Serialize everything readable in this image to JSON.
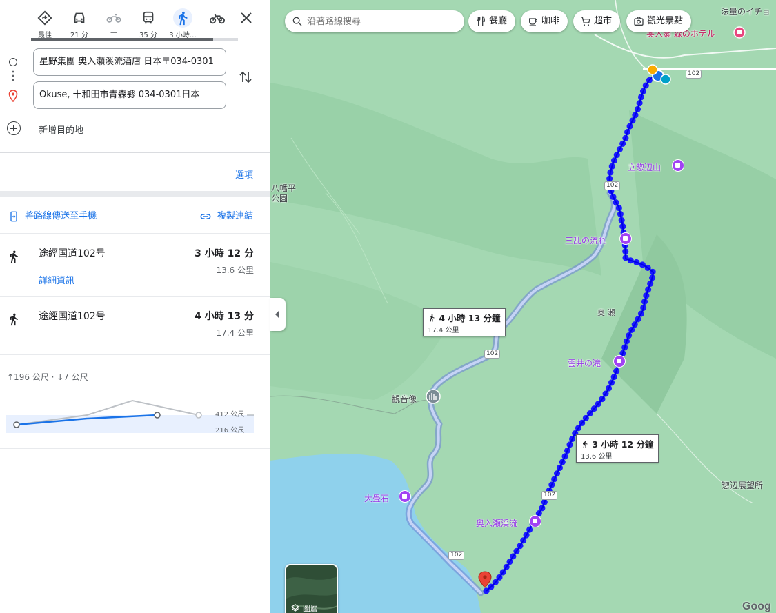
{
  "travel_modes": [
    {
      "name": "best",
      "label": "最佳",
      "icon": "directions-diamond-icon"
    },
    {
      "name": "driving",
      "label": "21 分",
      "icon": "car-icon"
    },
    {
      "name": "motorcycle",
      "label": "—",
      "icon": "motorcycle-icon"
    },
    {
      "name": "transit",
      "label": "35 分",
      "icon": "bus-icon"
    },
    {
      "name": "walking",
      "label": "3 小時…",
      "icon": "walk-icon",
      "selected": true
    },
    {
      "name": "cycling",
      "label": "",
      "icon": "bicycle-icon"
    }
  ],
  "waypoints": {
    "origin": "星野集團 奥入瀬溪流酒店 日本〒034-0301",
    "destination": "Okuse, 十和田市青森縣 034-0301日本",
    "add_destination": "新增目的地"
  },
  "options_label": "選項",
  "actions": {
    "send_to_phone": "將路線傳送至手機",
    "copy_link": "複製連結"
  },
  "routes": [
    {
      "via": "途經国道102号",
      "duration": "3 小時 12 分",
      "distance": "13.6 公里",
      "details": "詳細資訊"
    },
    {
      "via": "途經国道102号",
      "duration": "4 小時 13 分",
      "distance": "17.4 公里"
    }
  ],
  "elevation": {
    "summary": "↑196 公尺 · ↓7 公尺",
    "max_label": "412 公尺",
    "min_label": "216 公尺"
  },
  "map": {
    "search_placeholder": "沿著路線搜尋",
    "chips": [
      "餐廳",
      "咖啡",
      "超市",
      "觀光景點"
    ],
    "pois": {
      "hotel_top": "法量のイチョ",
      "hotel_mori": "奥入瀬 森のホテル",
      "tatsu": "立惣辺山",
      "sanran": "三乱の流れ",
      "oirase_area": "奥 瀬",
      "kumoi": "雲井の滝",
      "kannon": "観音像",
      "odatami": "大畳石",
      "oirase_keiryu": "奥入瀬渓流",
      "hachimantai": "八幡平",
      "park": "公園",
      "soheki": "惣辺展望所"
    },
    "route_label": "102",
    "callout_main": {
      "time": "3 小時 12 分鐘",
      "dist": "13.6 公里"
    },
    "callout_alt": {
      "time": "4 小時 13 分鐘",
      "dist": "17.4 公里"
    },
    "layers_label": "圖層",
    "brand": "Goog"
  },
  "colors": {
    "route_primary": "#1a1aff",
    "route_alt": "#8fa4e8",
    "accent": "#1a73e8",
    "water": "#8fd1ec",
    "terrain": "#a8dab5"
  }
}
